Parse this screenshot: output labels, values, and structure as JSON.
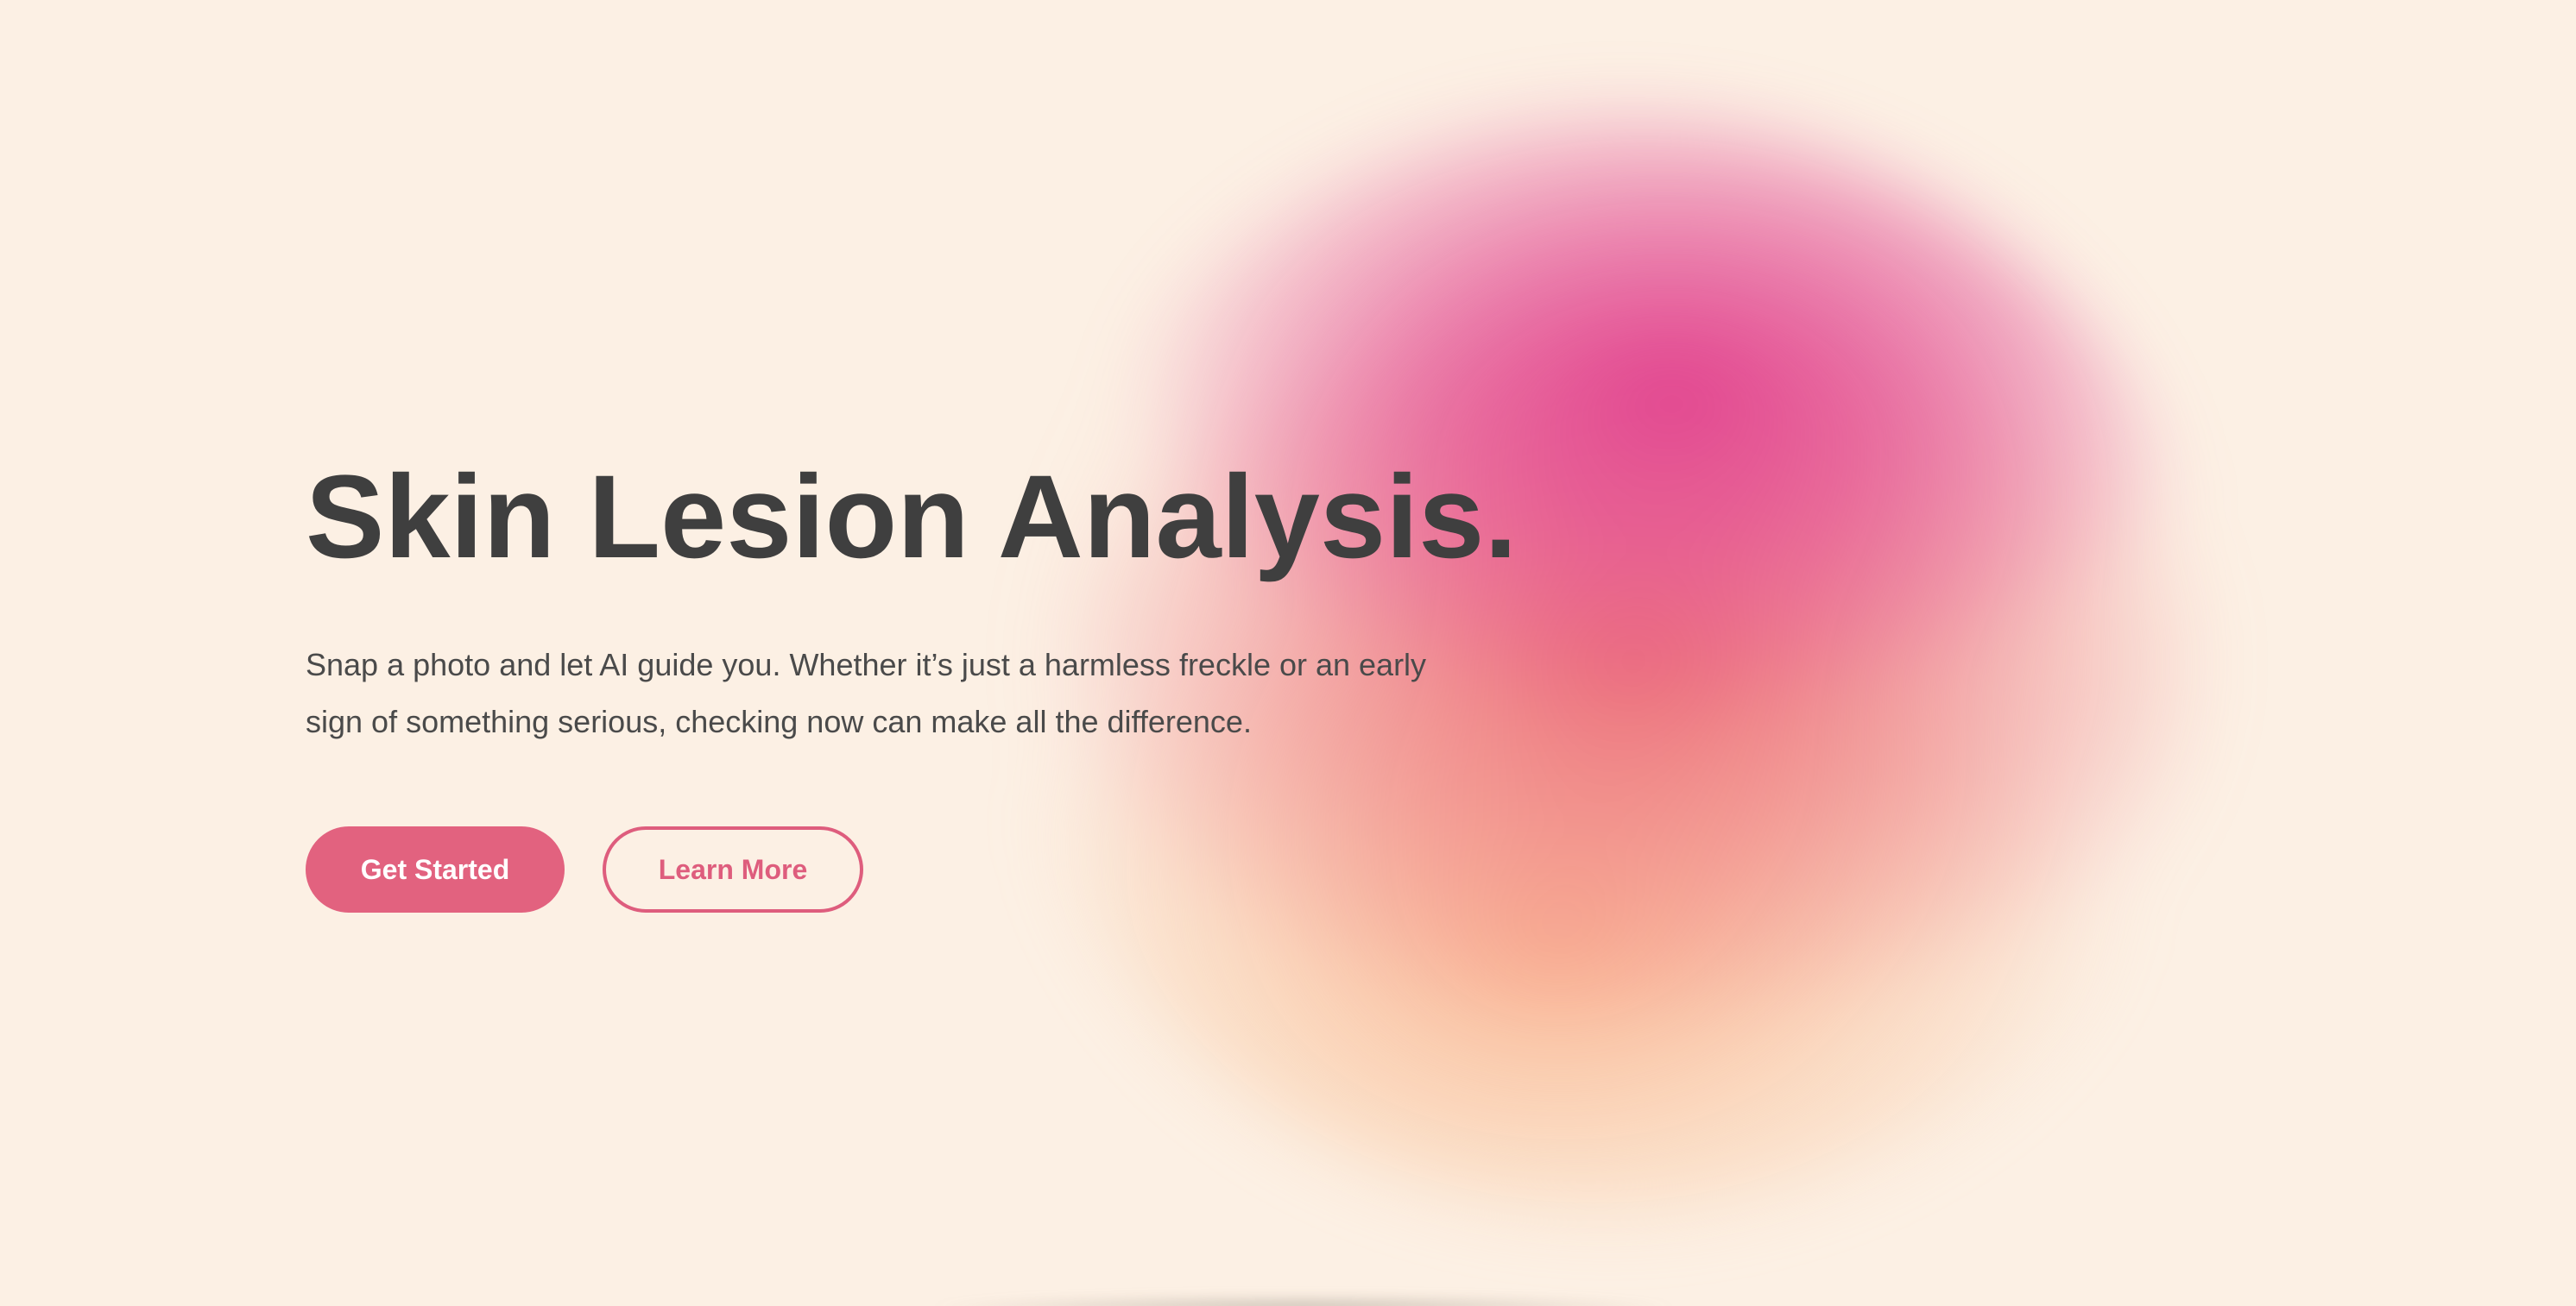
{
  "hero": {
    "title": "Skin Lesion Analysis.",
    "subtitle": "Snap a photo and let AI guide you. Whether it’s just a harmless freckle or an early sign of something serious, checking now can make all the difference.",
    "primary_button": "Get Started",
    "secondary_button": "Learn More"
  },
  "colors": {
    "background": "#fcf0e4",
    "text": "#3f3f3f",
    "accent": "#e2627f"
  }
}
